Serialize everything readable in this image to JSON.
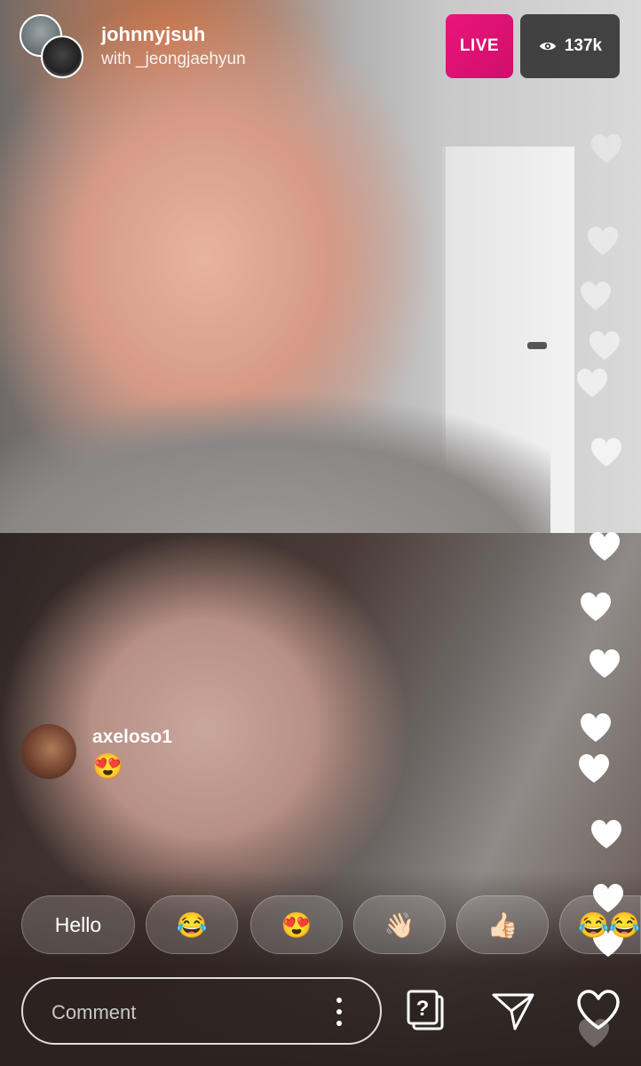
{
  "header": {
    "host_username": "johnnyjsuh",
    "with_line": "with _jeongjaehyun",
    "live_label": "LIVE",
    "viewer_count": "137k",
    "viewer_icon": "eye-icon"
  },
  "comment": {
    "username": "axeloso1",
    "text": "😍"
  },
  "quick_reactions": [
    "Hello",
    "😂",
    "😍",
    "👋🏻",
    "👍🏻",
    "😂😂"
  ],
  "composer": {
    "placeholder": "Comment",
    "more_icon": "vertical-dots-icon",
    "question_icon": "question-sticker-icon",
    "send_icon": "direct-send-icon",
    "like_icon": "heart-icon"
  },
  "colors": {
    "live_badge": "#e9157b",
    "viewer_badge": "#282828"
  }
}
